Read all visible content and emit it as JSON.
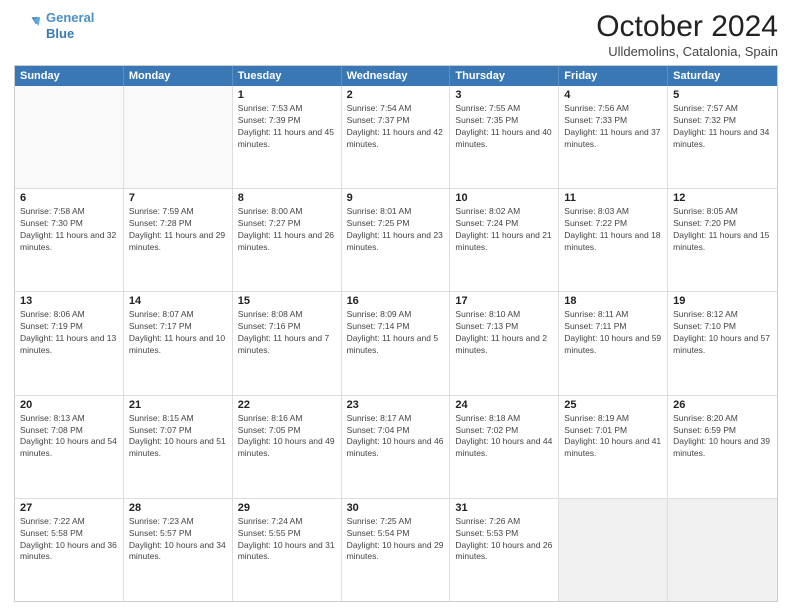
{
  "header": {
    "logo_line1": "General",
    "logo_line2": "Blue",
    "month": "October 2024",
    "location": "Ulldemolins, Catalonia, Spain"
  },
  "days_of_week": [
    "Sunday",
    "Monday",
    "Tuesday",
    "Wednesday",
    "Thursday",
    "Friday",
    "Saturday"
  ],
  "weeks": [
    [
      {
        "day": "",
        "empty": true
      },
      {
        "day": "",
        "empty": true
      },
      {
        "day": "1",
        "info": "Sunrise: 7:53 AM\nSunset: 7:39 PM\nDaylight: 11 hours and 45 minutes."
      },
      {
        "day": "2",
        "info": "Sunrise: 7:54 AM\nSunset: 7:37 PM\nDaylight: 11 hours and 42 minutes."
      },
      {
        "day": "3",
        "info": "Sunrise: 7:55 AM\nSunset: 7:35 PM\nDaylight: 11 hours and 40 minutes."
      },
      {
        "day": "4",
        "info": "Sunrise: 7:56 AM\nSunset: 7:33 PM\nDaylight: 11 hours and 37 minutes."
      },
      {
        "day": "5",
        "info": "Sunrise: 7:57 AM\nSunset: 7:32 PM\nDaylight: 11 hours and 34 minutes."
      }
    ],
    [
      {
        "day": "6",
        "info": "Sunrise: 7:58 AM\nSunset: 7:30 PM\nDaylight: 11 hours and 32 minutes."
      },
      {
        "day": "7",
        "info": "Sunrise: 7:59 AM\nSunset: 7:28 PM\nDaylight: 11 hours and 29 minutes."
      },
      {
        "day": "8",
        "info": "Sunrise: 8:00 AM\nSunset: 7:27 PM\nDaylight: 11 hours and 26 minutes."
      },
      {
        "day": "9",
        "info": "Sunrise: 8:01 AM\nSunset: 7:25 PM\nDaylight: 11 hours and 23 minutes."
      },
      {
        "day": "10",
        "info": "Sunrise: 8:02 AM\nSunset: 7:24 PM\nDaylight: 11 hours and 21 minutes."
      },
      {
        "day": "11",
        "info": "Sunrise: 8:03 AM\nSunset: 7:22 PM\nDaylight: 11 hours and 18 minutes."
      },
      {
        "day": "12",
        "info": "Sunrise: 8:05 AM\nSunset: 7:20 PM\nDaylight: 11 hours and 15 minutes."
      }
    ],
    [
      {
        "day": "13",
        "info": "Sunrise: 8:06 AM\nSunset: 7:19 PM\nDaylight: 11 hours and 13 minutes."
      },
      {
        "day": "14",
        "info": "Sunrise: 8:07 AM\nSunset: 7:17 PM\nDaylight: 11 hours and 10 minutes."
      },
      {
        "day": "15",
        "info": "Sunrise: 8:08 AM\nSunset: 7:16 PM\nDaylight: 11 hours and 7 minutes."
      },
      {
        "day": "16",
        "info": "Sunrise: 8:09 AM\nSunset: 7:14 PM\nDaylight: 11 hours and 5 minutes."
      },
      {
        "day": "17",
        "info": "Sunrise: 8:10 AM\nSunset: 7:13 PM\nDaylight: 11 hours and 2 minutes."
      },
      {
        "day": "18",
        "info": "Sunrise: 8:11 AM\nSunset: 7:11 PM\nDaylight: 10 hours and 59 minutes."
      },
      {
        "day": "19",
        "info": "Sunrise: 8:12 AM\nSunset: 7:10 PM\nDaylight: 10 hours and 57 minutes."
      }
    ],
    [
      {
        "day": "20",
        "info": "Sunrise: 8:13 AM\nSunset: 7:08 PM\nDaylight: 10 hours and 54 minutes."
      },
      {
        "day": "21",
        "info": "Sunrise: 8:15 AM\nSunset: 7:07 PM\nDaylight: 10 hours and 51 minutes."
      },
      {
        "day": "22",
        "info": "Sunrise: 8:16 AM\nSunset: 7:05 PM\nDaylight: 10 hours and 49 minutes."
      },
      {
        "day": "23",
        "info": "Sunrise: 8:17 AM\nSunset: 7:04 PM\nDaylight: 10 hours and 46 minutes."
      },
      {
        "day": "24",
        "info": "Sunrise: 8:18 AM\nSunset: 7:02 PM\nDaylight: 10 hours and 44 minutes."
      },
      {
        "day": "25",
        "info": "Sunrise: 8:19 AM\nSunset: 7:01 PM\nDaylight: 10 hours and 41 minutes."
      },
      {
        "day": "26",
        "info": "Sunrise: 8:20 AM\nSunset: 6:59 PM\nDaylight: 10 hours and 39 minutes."
      }
    ],
    [
      {
        "day": "27",
        "info": "Sunrise: 7:22 AM\nSunset: 5:58 PM\nDaylight: 10 hours and 36 minutes."
      },
      {
        "day": "28",
        "info": "Sunrise: 7:23 AM\nSunset: 5:57 PM\nDaylight: 10 hours and 34 minutes."
      },
      {
        "day": "29",
        "info": "Sunrise: 7:24 AM\nSunset: 5:55 PM\nDaylight: 10 hours and 31 minutes."
      },
      {
        "day": "30",
        "info": "Sunrise: 7:25 AM\nSunset: 5:54 PM\nDaylight: 10 hours and 29 minutes."
      },
      {
        "day": "31",
        "info": "Sunrise: 7:26 AM\nSunset: 5:53 PM\nDaylight: 10 hours and 26 minutes."
      },
      {
        "day": "",
        "empty": true,
        "shaded": true
      },
      {
        "day": "",
        "empty": true,
        "shaded": true
      }
    ]
  ]
}
